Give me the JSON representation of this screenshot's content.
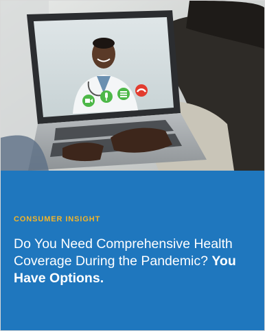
{
  "article": {
    "image": {
      "subject": "telehealth video call with doctor on laptop"
    },
    "category": "CONSUMER INSIGHT",
    "headline_lead": "Do You Need Comprehensive Health  Coverage During the Pandemic?",
    "headline_emphasis": "You Have Options."
  },
  "colors": {
    "panel_blue": "#1f77be",
    "eyebrow_gold": "#f3b52a",
    "call_green": "#4db848",
    "hangup_red": "#e23b2e"
  },
  "icons": [
    "video-camera-icon",
    "microphone-icon",
    "chat-icon",
    "phone-hangup-icon"
  ]
}
